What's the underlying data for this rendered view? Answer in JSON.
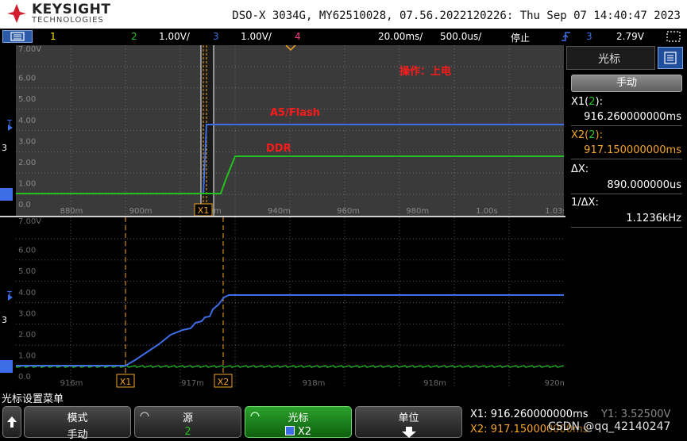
{
  "header": {
    "brand": "KEYSIGHT",
    "brand_sub": "TECHNOLOGIES",
    "instrument_info": "DSO-X 3034G, MY62510028, 07.56.2022120226: Thu Sep 07 14:40:47 2023"
  },
  "status_bar": {
    "ch1_label": "1",
    "ch2_label": "2",
    "ch2_scale": "1.00V/",
    "ch3_label": "3",
    "ch3_scale": "1.00V/",
    "ch4_label": "4",
    "timebase": "20.00ms/",
    "delay": "500.0us/",
    "run_state": "停止",
    "trigger_channel": "3",
    "trigger_level": "2.79V"
  },
  "upper_display": {
    "y_labels": [
      "7.00V",
      "6.00",
      "5.00",
      "4.00",
      "3.00",
      "2.00",
      "1.00",
      "0.0"
    ],
    "x_labels": [
      "880m",
      "900m",
      "920m",
      "940m",
      "960m",
      "980m",
      "1.00s",
      "1.03s"
    ],
    "annotation_operation": "操作：上电",
    "annotation_a5": "A5/Flash",
    "annotation_ddr": "DDR",
    "cursor_x1_label": "X1",
    "channel_marker": "3",
    "trigger_marker": "T"
  },
  "lower_display": {
    "y_labels": [
      "7.00V",
      "6.00",
      "5.00",
      "4.00",
      "3.00",
      "2.00",
      "1.00",
      "0.0"
    ],
    "x_labels": [
      "916m",
      "917m",
      "918m",
      "918m",
      "920m"
    ],
    "cursor_x1_label": "X1",
    "cursor_x2_label": "X2",
    "channel_marker": "3",
    "trigger_marker": "T"
  },
  "side_panel": {
    "title": "光标",
    "mode_button": "手动",
    "x1_label": "X1(",
    "x1_src": "2",
    "x1_suffix": "):",
    "x1_value": "916.260000000ms",
    "x2_label": "X2(",
    "x2_src": "2",
    "x2_suffix": "):",
    "x2_value": "917.150000000ms",
    "dx_label": "ΔX:",
    "dx_value": "890.000000us",
    "inv_dx_label": "1/ΔX:",
    "inv_dx_value": "1.1236kHz"
  },
  "menu": {
    "title": "光标设置菜单",
    "softkeys": [
      {
        "line1": "模式",
        "line2": "手动"
      },
      {
        "line1": "源",
        "line2": "2"
      },
      {
        "line1": "光标",
        "line2": "X2"
      },
      {
        "line1": "单位",
        "line2": ""
      }
    ]
  },
  "readout": {
    "x1_line": "X1: 916.260000000ms",
    "y1_line": "Y1: 3.52500V",
    "x2_line": "X2: 917.150000000ms",
    "watermark": "CSDN @qq_42140247"
  },
  "colors": {
    "ch1": "#f2e600",
    "ch2": "#23c11e",
    "ch3": "#3d6ee8",
    "ch4": "#ff3d8a",
    "cursor": "#f5a623",
    "annotation": "#ff1a1a"
  }
}
